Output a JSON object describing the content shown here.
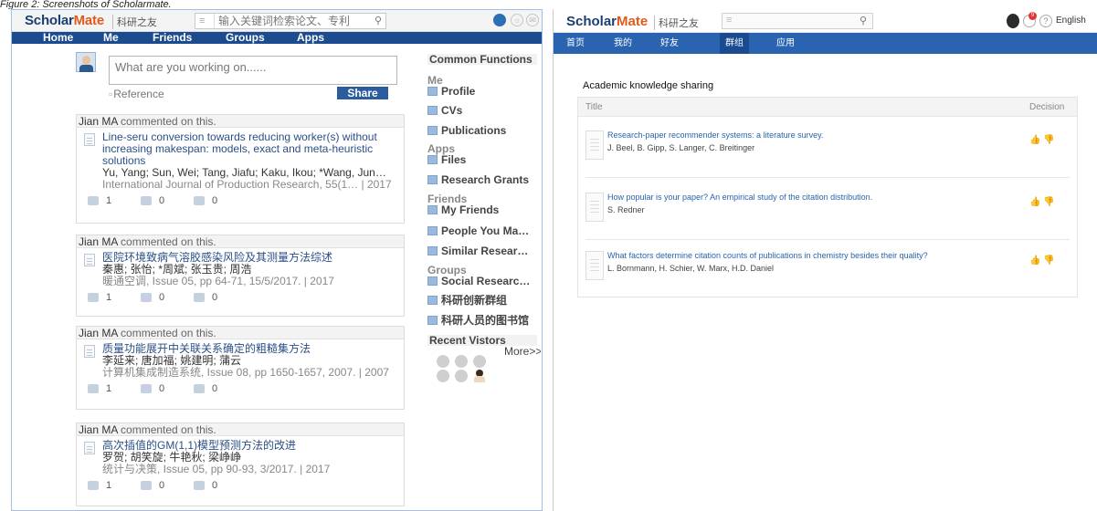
{
  "caption": "Figure 2: Screenshots of Scholarmate.",
  "left": {
    "logo_main": "ScholarMate",
    "logo_sub": "科研之友",
    "search_placeholder": "输入关键词检索论文、专利",
    "nav": [
      "Home",
      "Me",
      "Friends",
      "Groups",
      "Apps"
    ],
    "composer_placeholder": "What are you working on......",
    "reference_label": "Reference",
    "share_label": "Share",
    "feed": [
      {
        "commenter": "Jian MA",
        "action": "commented on this.",
        "title": "Line-seru conversion towards reducing worker(s) without increasing makespan: models, exact and meta-heuristic solutions",
        "authors": "Yu, Yang; Sun, Wei; Tang, Jiafu; Kaku, Ikou; *Wang, Jun…",
        "source": "International Journal of Production Research, 55(1… | 2017",
        "likes": "1",
        "comments": "0",
        "shares": "0"
      },
      {
        "commenter": "Jian MA",
        "action": "commented on this.",
        "title": "医院环境致病气溶胶感染风险及其测量方法综述",
        "authors": "秦惠; 张怡; *周斌; 张玉贵; 周浩",
        "source": "暖通空调, Issue 05, pp 64-71, 15/5/2017. | 2017",
        "likes": "1",
        "comments": "0",
        "shares": "0"
      },
      {
        "commenter": "Jian MA",
        "action": "commented on this.",
        "title": "质量功能展开中关联关系确定的粗糙集方法",
        "authors": "李延来; 唐加福; 姚建明; 蒲云",
        "source": "计算机集成制造系统, Issue 08, pp 1650-1657, 2007. | 2007",
        "likes": "1",
        "comments": "0",
        "shares": "0"
      },
      {
        "commenter": "Jian MA",
        "action": "commented on this.",
        "title": "高次插值的GM(1,1)模型预测方法的改进",
        "authors": "罗贺; 胡笑旋; 牛艳秋; 梁峥峥",
        "source": "统计与决策, Issue 05, pp 90-93, 3/2017. | 2017",
        "likes": "1",
        "comments": "0",
        "shares": "0"
      }
    ],
    "sidebar": {
      "heading": "Common Functions",
      "sec_me": "Me",
      "profile": "Profile",
      "cvs": "CVs",
      "publications": "Publications",
      "sec_apps": "Apps",
      "files": "Files",
      "grants": "Research Grants",
      "sec_friends": "Friends",
      "my_friends": "My Friends",
      "people": "People You Ma…",
      "similar": "Similar Resear…",
      "sec_groups": "Groups",
      "social": "Social Researc…",
      "group1": "科研创新群组",
      "group2": "科研人员的图书馆",
      "visitors": "Recent Vistors",
      "more": "More>>"
    }
  },
  "right": {
    "logo_main": "ScholarMate",
    "logo_sub": "科研之友",
    "badge": "9",
    "help": "?",
    "language": "English",
    "nav": [
      "首页",
      "我的",
      "好友",
      "群组",
      "应用"
    ],
    "active_nav": "群组",
    "section_title": "Academic knowledge sharing",
    "col_title": "Title",
    "col_decision": "Decision",
    "papers": [
      {
        "title": "Research-paper recommender systems: a literature survey.",
        "authors": "J. Beel, B. Gipp, S. Langer, C. Breitinger"
      },
      {
        "title": "How popular is your paper? An empirical study of the citation distribution.",
        "authors": "S. Redner"
      },
      {
        "title": "What factors determine citation counts of publications in chemistry besides their quality?",
        "authors": "L. Bornmann, H. Schier, W. Marx, H.D. Daniel"
      }
    ]
  }
}
